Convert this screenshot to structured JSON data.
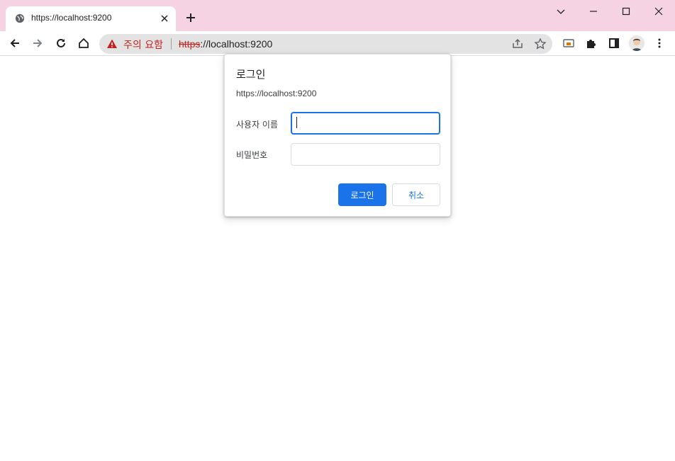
{
  "browser": {
    "tab": {
      "title": "https://localhost:9200",
      "favicon": "globe-icon"
    },
    "omnibox": {
      "security_label": "주의 요함",
      "url_scheme": "https",
      "url_rest": "://localhost:9200"
    },
    "colors": {
      "frame": "#f6d3e2",
      "warning": "#c5221f",
      "accent": "#1a73e8"
    }
  },
  "dialog": {
    "title": "로그인",
    "origin": "https://localhost:9200",
    "username_label": "사용자 이름",
    "username_value": "",
    "password_label": "비밀번호",
    "password_value": "",
    "login_button": "로그인",
    "cancel_button": "취소"
  }
}
